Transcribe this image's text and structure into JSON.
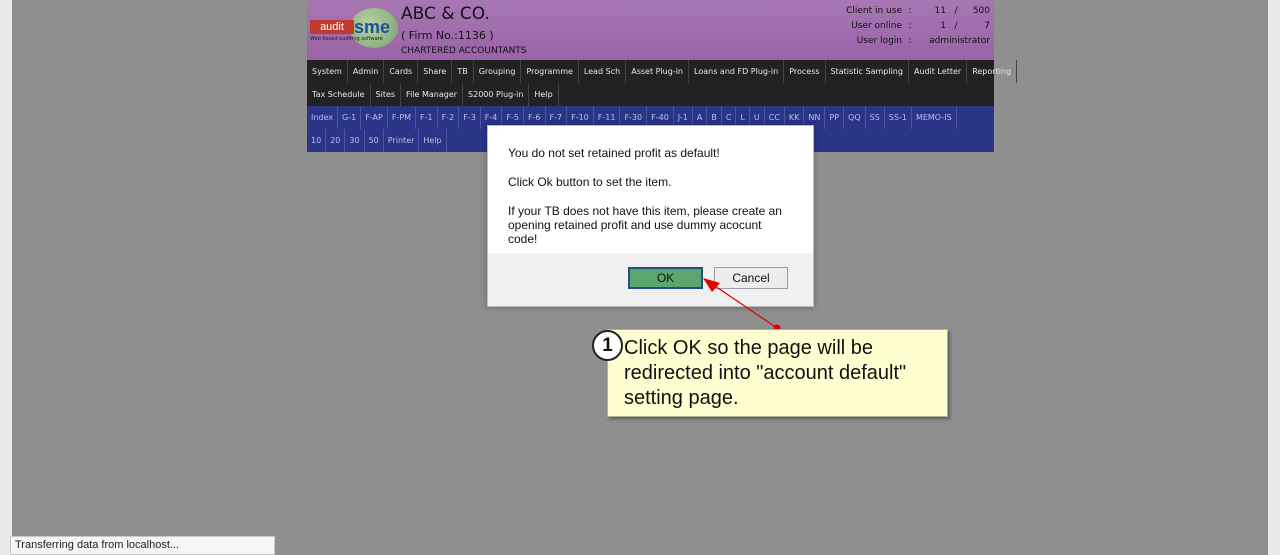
{
  "header": {
    "logo_audit": "audit",
    "logo_sme": "sme",
    "logo_tag": "Web based auditing software",
    "firm_name": "ABC & CO.",
    "firm_no": "( Firm No.:1136 )",
    "firm_sub": "CHARTERED ACCOUNTANTS",
    "stats": {
      "client_label": "Client in use",
      "client_value": "11",
      "client_sep": "/",
      "client_total": "500",
      "online_label": "User online",
      "online_value": "1",
      "online_sep": "/",
      "online_total": "7",
      "login_label": "User login",
      "login_value": "administrator",
      "colon": ":"
    }
  },
  "menu": {
    "row1": [
      "System",
      "Admin",
      "Cards",
      "Share",
      "TB",
      "Grouping",
      "Programme",
      "Lead Sch",
      "Asset Plug-in",
      "Loans and FD Plug-in",
      "Process",
      "Statistic Sampling",
      "Audit Letter",
      "Reporting"
    ],
    "row2": [
      "Tax Schedule",
      "Sites",
      "File Manager",
      "S2000 Plug-in",
      "Help"
    ]
  },
  "subnav": {
    "row1": [
      "Index",
      "G-1",
      "F-AP",
      "F-PM",
      "F-1",
      "F-2",
      "F-3",
      "F-4",
      "F-5",
      "F-6",
      "F-7",
      "F-10",
      "F-11",
      "F-30",
      "F-40",
      "J-1",
      "A",
      "B",
      "C",
      "L",
      "U",
      "CC",
      "KK",
      "NN",
      "PP",
      "QQ",
      "SS",
      "SS-1",
      "MEMO-IS"
    ],
    "row2": [
      "10",
      "20",
      "30",
      "50",
      "Printer",
      "Help"
    ]
  },
  "dialog": {
    "line1": "You do not set retained profit as default!",
    "line2": "Click Ok button to set the item.",
    "line3": "If your TB does not have this item, please create an opening retained profit and use dummy acocunt code!",
    "ok_label": "OK",
    "cancel_label": "Cancel"
  },
  "callout": {
    "number": "1",
    "text": "Click OK so the page will be redirected into \"account default\" setting page."
  },
  "status": {
    "text": "Transferring data from localhost..."
  },
  "colors": {
    "header_bg": "#9a62a7",
    "menu_bg": "#222222",
    "subnav_bg": "#2a3588",
    "ok_button": "#5aa66e",
    "arrow": "#e00000",
    "callout_bg": "#fefed0"
  }
}
